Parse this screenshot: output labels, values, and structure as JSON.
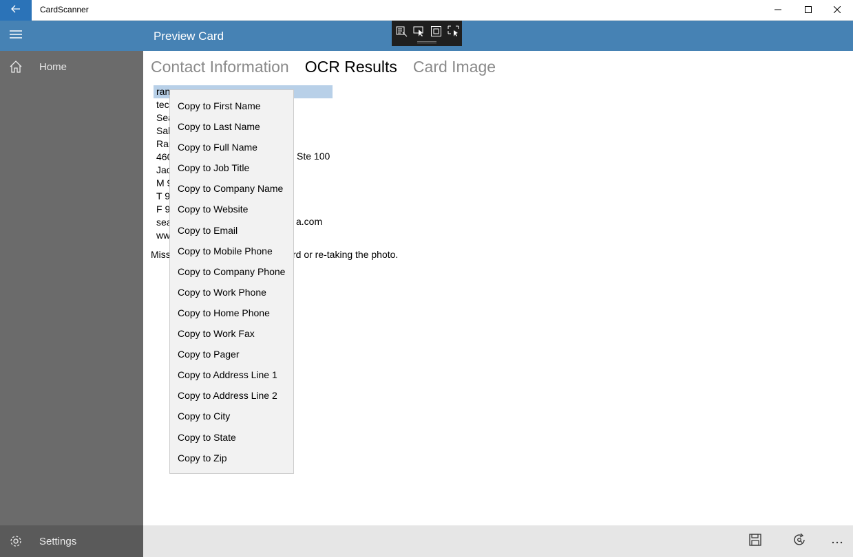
{
  "window": {
    "title": "CardScanner",
    "back_icon": "back-arrow-icon",
    "minimize_icon": "minimize-icon",
    "maximize_icon": "maximize-icon",
    "close_icon": "close-icon"
  },
  "header": {
    "menu_icon": "hamburger-icon",
    "title": "Preview Card"
  },
  "overlay_toolbar": {
    "tools": [
      "select-element-icon",
      "pointer-icon",
      "frame-icon",
      "screen-select-icon"
    ]
  },
  "sidebar": {
    "items": [
      {
        "label": "Home",
        "icon": "home-icon"
      }
    ],
    "settings": {
      "label": "Settings",
      "icon": "gear-icon"
    }
  },
  "pivot": {
    "tabs": [
      {
        "label": "Contact Information",
        "active": false
      },
      {
        "label": "OCR Results",
        "active": true
      },
      {
        "label": "Card Image",
        "active": false
      }
    ]
  },
  "ocr": {
    "lines": [
      "ran",
      "tec",
      "Sea",
      "Sal",
      "Rar",
      "460",
      "Jac",
      "M 9",
      "T 9",
      "F 9",
      "sea",
      "ww"
    ],
    "line5_tail": "Ste 100",
    "line11_tail": "a.com",
    "note_start": "Miss",
    "note_end": "rd or re-taking the photo."
  },
  "context_menu": {
    "items": [
      "Copy to First Name",
      "Copy to Last Name",
      "Copy to Full Name",
      "Copy to Job Title",
      "Copy to Company Name",
      "Copy to Website",
      "Copy to Email",
      "Copy to Mobile Phone",
      "Copy to Company Phone",
      "Copy to Work Phone",
      "Copy to Home Phone",
      "Copy to Work Fax",
      "Copy to Pager",
      "Copy to Address Line 1",
      "Copy to Address Line 2",
      "Copy to City",
      "Copy to State",
      "Copy to Zip"
    ]
  },
  "command_bar": {
    "buttons": [
      "save-icon",
      "rescan-icon",
      "more-icon"
    ]
  },
  "colors": {
    "accent": "#4682b4",
    "back_button": "#2b73b8",
    "sidebar": "#6b6b6b",
    "selection": "#b8d0e8",
    "menu_bg": "#f2f2f2"
  }
}
